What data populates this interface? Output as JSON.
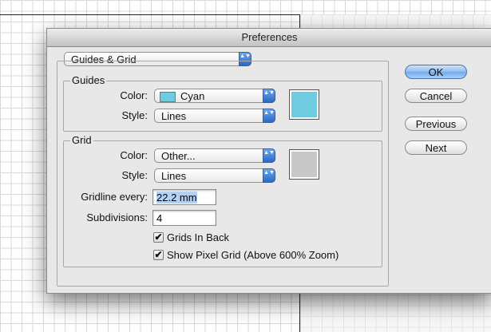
{
  "dialog": {
    "title": "Preferences"
  },
  "section_popup": {
    "value": "Guides & Grid",
    "stepper_glyph": "▲▼"
  },
  "guides": {
    "title": "Guides",
    "color_label": "Color:",
    "color_value": "Cyan",
    "color_hex": "#6fcbe0",
    "style_label": "Style:",
    "style_value": "Lines"
  },
  "grid": {
    "title": "Grid",
    "color_label": "Color:",
    "color_value": "Other...",
    "color_hex": "#c8c8c8",
    "style_label": "Style:",
    "style_value": "Lines",
    "gridline_label": "Gridline every:",
    "gridline_value": "22.2 mm",
    "subdivisions_label": "Subdivisions:",
    "subdivisions_value": "4",
    "grids_in_back_label": "Grids In Back",
    "grids_in_back_checked": true,
    "show_pixel_grid_label": "Show Pixel Grid (Above 600% Zoom)",
    "show_pixel_grid_checked": true
  },
  "buttons": {
    "ok": "OK",
    "cancel": "Cancel",
    "previous": "Previous",
    "next": "Next"
  },
  "check_glyph": "✔"
}
